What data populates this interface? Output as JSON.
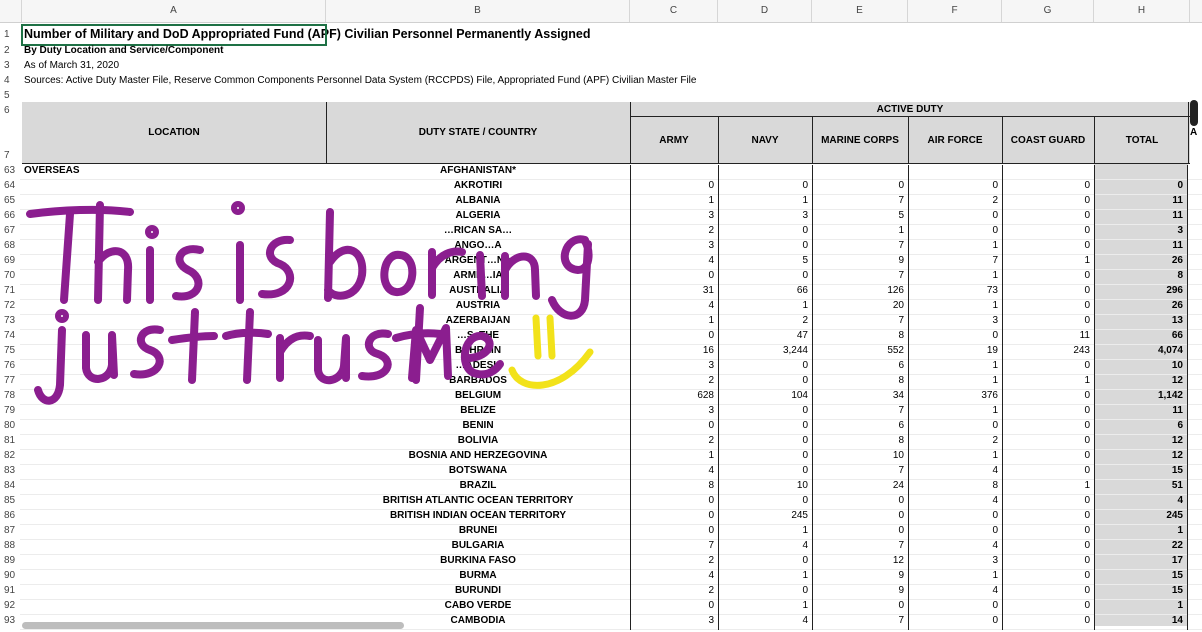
{
  "columns": [
    "A",
    "B",
    "C",
    "D",
    "E",
    "F",
    "G",
    "H"
  ],
  "top_rows": [
    {
      "num": "1",
      "text": "Number of Military and DoD Appropriated Fund (APF) Civilian Personnel Permanently Assigned"
    },
    {
      "num": "2",
      "text": "By Duty Location and Service/Component"
    },
    {
      "num": "3",
      "text": "As of March 31, 2020"
    },
    {
      "num": "4",
      "text": "Sources: Active Duty Master File, Reserve Common Components Personnel Data System (RCCPDS) File, Appropriated Fund (APF) Civilian Master File"
    },
    {
      "num": "5",
      "text": ""
    },
    {
      "num": "6",
      "text": ""
    },
    {
      "num": "7",
      "text": ""
    }
  ],
  "header": {
    "location": "LOCATION",
    "duty_state": "DUTY STATE / COUNTRY",
    "active_duty": "ACTIVE DUTY",
    "army": "ARMY",
    "navy": "NAVY",
    "marine": "MARINE CORPS",
    "airforce": "AIR FORCE",
    "coastguard": "COAST GUARD",
    "total": "TOTAL",
    "next": "A"
  },
  "rows": [
    {
      "num": "63",
      "loc": "OVERSEAS",
      "country": "AFGHANISTAN*",
      "army": "",
      "navy": "",
      "marine": "",
      "af": "",
      "cg": "",
      "total": ""
    },
    {
      "num": "64",
      "loc": "",
      "country": "AKROTIRI",
      "army": "0",
      "navy": "0",
      "marine": "0",
      "af": "0",
      "cg": "0",
      "total": "0"
    },
    {
      "num": "65",
      "loc": "",
      "country": "ALBANIA",
      "army": "1",
      "navy": "1",
      "marine": "7",
      "af": "2",
      "cg": "0",
      "total": "11"
    },
    {
      "num": "66",
      "loc": "",
      "country": "ALGERIA",
      "army": "3",
      "navy": "3",
      "marine": "5",
      "af": "0",
      "cg": "0",
      "total": "11"
    },
    {
      "num": "67",
      "loc": "",
      "country": "…RICAN SA…",
      "army": "2",
      "navy": "0",
      "marine": "1",
      "af": "0",
      "cg": "0",
      "total": "3"
    },
    {
      "num": "68",
      "loc": "",
      "country": "ANGO…A",
      "army": "3",
      "navy": "0",
      "marine": "7",
      "af": "1",
      "cg": "0",
      "total": "11"
    },
    {
      "num": "69",
      "loc": "",
      "country": "ARGENT…NA",
      "army": "4",
      "navy": "5",
      "marine": "9",
      "af": "7",
      "cg": "1",
      "total": "26"
    },
    {
      "num": "70",
      "loc": "",
      "country": "ARME…IA",
      "army": "0",
      "navy": "0",
      "marine": "7",
      "af": "1",
      "cg": "0",
      "total": "8"
    },
    {
      "num": "71",
      "loc": "",
      "country": "AUSTRALIA",
      "army": "31",
      "navy": "66",
      "marine": "126",
      "af": "73",
      "cg": "0",
      "total": "296"
    },
    {
      "num": "72",
      "loc": "",
      "country": "AUSTRIA",
      "army": "4",
      "navy": "1",
      "marine": "20",
      "af": "1",
      "cg": "0",
      "total": "26"
    },
    {
      "num": "73",
      "loc": "",
      "country": "AZERBAIJAN",
      "army": "1",
      "navy": "2",
      "marine": "7",
      "af": "3",
      "cg": "0",
      "total": "13"
    },
    {
      "num": "74",
      "loc": "",
      "country": "…S, THE",
      "army": "0",
      "navy": "47",
      "marine": "8",
      "af": "0",
      "cg": "11",
      "total": "66"
    },
    {
      "num": "75",
      "loc": "",
      "country": "BAHRAIN",
      "army": "16",
      "navy": "3,244",
      "marine": "552",
      "af": "19",
      "cg": "243",
      "total": "4,074"
    },
    {
      "num": "76",
      "loc": "",
      "country": "…ADESH",
      "army": "3",
      "navy": "0",
      "marine": "6",
      "af": "1",
      "cg": "0",
      "total": "10"
    },
    {
      "num": "77",
      "loc": "",
      "country": "BARBADOS",
      "army": "2",
      "navy": "0",
      "marine": "8",
      "af": "1",
      "cg": "1",
      "total": "12"
    },
    {
      "num": "78",
      "loc": "",
      "country": "BELGIUM",
      "army": "628",
      "navy": "104",
      "marine": "34",
      "af": "376",
      "cg": "0",
      "total": "1,142"
    },
    {
      "num": "79",
      "loc": "",
      "country": "BELIZE",
      "army": "3",
      "navy": "0",
      "marine": "7",
      "af": "1",
      "cg": "0",
      "total": "11"
    },
    {
      "num": "80",
      "loc": "",
      "country": "BENIN",
      "army": "0",
      "navy": "0",
      "marine": "6",
      "af": "0",
      "cg": "0",
      "total": "6"
    },
    {
      "num": "81",
      "loc": "",
      "country": "BOLIVIA",
      "army": "2",
      "navy": "0",
      "marine": "8",
      "af": "2",
      "cg": "0",
      "total": "12"
    },
    {
      "num": "82",
      "loc": "",
      "country": "BOSNIA AND HERZEGOVINA",
      "army": "1",
      "navy": "0",
      "marine": "10",
      "af": "1",
      "cg": "0",
      "total": "12"
    },
    {
      "num": "83",
      "loc": "",
      "country": "BOTSWANA",
      "army": "4",
      "navy": "0",
      "marine": "7",
      "af": "4",
      "cg": "0",
      "total": "15"
    },
    {
      "num": "84",
      "loc": "",
      "country": "BRAZIL",
      "army": "8",
      "navy": "10",
      "marine": "24",
      "af": "8",
      "cg": "1",
      "total": "51"
    },
    {
      "num": "85",
      "loc": "",
      "country": "BRITISH ATLANTIC OCEAN TERRITORY",
      "army": "0",
      "navy": "0",
      "marine": "0",
      "af": "4",
      "cg": "0",
      "total": "4"
    },
    {
      "num": "86",
      "loc": "",
      "country": "BRITISH INDIAN OCEAN TERRITORY",
      "army": "0",
      "navy": "245",
      "marine": "0",
      "af": "0",
      "cg": "0",
      "total": "245"
    },
    {
      "num": "87",
      "loc": "",
      "country": "BRUNEI",
      "army": "0",
      "navy": "1",
      "marine": "0",
      "af": "0",
      "cg": "0",
      "total": "1"
    },
    {
      "num": "88",
      "loc": "",
      "country": "BULGARIA",
      "army": "7",
      "navy": "4",
      "marine": "7",
      "af": "4",
      "cg": "0",
      "total": "22"
    },
    {
      "num": "89",
      "loc": "",
      "country": "BURKINA FASO",
      "army": "2",
      "navy": "0",
      "marine": "12",
      "af": "3",
      "cg": "0",
      "total": "17"
    },
    {
      "num": "90",
      "loc": "",
      "country": "BURMA",
      "army": "4",
      "navy": "1",
      "marine": "9",
      "af": "1",
      "cg": "0",
      "total": "15"
    },
    {
      "num": "91",
      "loc": "",
      "country": "BURUNDI",
      "army": "2",
      "navy": "0",
      "marine": "9",
      "af": "4",
      "cg": "0",
      "total": "15"
    },
    {
      "num": "92",
      "loc": "",
      "country": "CABO VERDE",
      "army": "0",
      "navy": "1",
      "marine": "0",
      "af": "0",
      "cg": "0",
      "total": "1"
    },
    {
      "num": "93",
      "loc": "",
      "country": "CAMBODIA",
      "army": "3",
      "navy": "4",
      "marine": "7",
      "af": "0",
      "cg": "0",
      "total": "14"
    }
  ],
  "doodle": {
    "line1": "This is boring",
    "line2": "just trust me",
    "purple": "#8b1e8f",
    "yellow": "#f2e21a"
  }
}
